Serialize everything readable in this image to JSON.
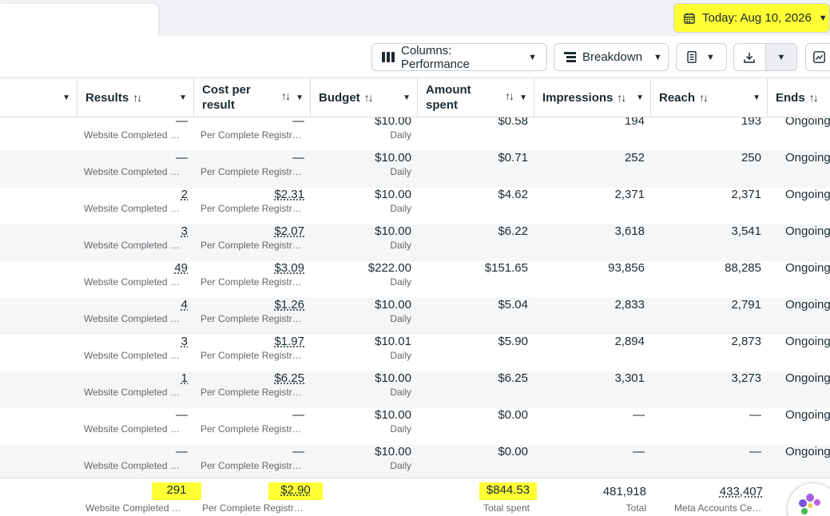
{
  "date_picker": {
    "label": "Today: Aug 10, 2026"
  },
  "toolbar": {
    "columns_label": "Columns: Performance",
    "breakdown_label": "Breakdown"
  },
  "columns": [
    {
      "label": "Results"
    },
    {
      "label": "Cost per result"
    },
    {
      "label": "Budget"
    },
    {
      "label": "Amount spent"
    },
    {
      "label": "Impressions"
    },
    {
      "label": "Reach"
    },
    {
      "label": "Ends"
    }
  ],
  "rows": [
    {
      "results": "—",
      "results_sub": "Website Completed Registrations",
      "cpr": "—",
      "cpr_sub": "Per Complete Registration",
      "budget": "$10.00",
      "budget_sub": "Daily",
      "spent": "$0.58",
      "impressions": "194",
      "reach": "193",
      "ends": "Ongoing"
    },
    {
      "results": "—",
      "results_sub": "Website Completed Registrations",
      "cpr": "—",
      "cpr_sub": "Per Complete Registration",
      "budget": "$10.00",
      "budget_sub": "Daily",
      "spent": "$0.71",
      "impressions": "252",
      "reach": "250",
      "ends": "Ongoing"
    },
    {
      "results": "2",
      "results_sub": "Website Completed Registrations",
      "cpr": "$2.31",
      "cpr_sub": "Per Complete Registration",
      "budget": "$10.00",
      "budget_sub": "Daily",
      "spent": "$4.62",
      "impressions": "2,371",
      "reach": "2,371",
      "ends": "Ongoing"
    },
    {
      "results": "3",
      "results_sub": "Website Completed Registrations",
      "cpr": "$2.07",
      "cpr_sub": "Per Complete Registration",
      "budget": "$10.00",
      "budget_sub": "Daily",
      "spent": "$6.22",
      "impressions": "3,618",
      "reach": "3,541",
      "ends": "Ongoing"
    },
    {
      "results": "49",
      "results_sub": "Website Completed Registrations",
      "cpr": "$3.09",
      "cpr_sub": "Per Complete Registration",
      "budget": "$222.00",
      "budget_sub": "Daily",
      "spent": "$151.65",
      "impressions": "93,856",
      "reach": "88,285",
      "ends": "Ongoing"
    },
    {
      "results": "4",
      "results_sub": "Website Completed Registrations",
      "cpr": "$1.26",
      "cpr_sub": "Per Complete Registration",
      "budget": "$10.00",
      "budget_sub": "Daily",
      "spent": "$5.04",
      "impressions": "2,833",
      "reach": "2,791",
      "ends": "Ongoing"
    },
    {
      "results": "3",
      "results_sub": "Website Completed Registrations",
      "cpr": "$1.97",
      "cpr_sub": "Per Complete Registration",
      "budget": "$10.01",
      "budget_sub": "Daily",
      "spent": "$5.90",
      "impressions": "2,894",
      "reach": "2,873",
      "ends": "Ongoing"
    },
    {
      "results": "1",
      "results_sub": "Website Completed Registrations",
      "cpr": "$6.25",
      "cpr_sub": "Per Complete Registration",
      "budget": "$10.00",
      "budget_sub": "Daily",
      "spent": "$6.25",
      "impressions": "3,301",
      "reach": "3,273",
      "ends": "Ongoing"
    },
    {
      "results": "—",
      "results_sub": "Website Completed Registrations",
      "cpr": "—",
      "cpr_sub": "Per Complete Registration",
      "budget": "$10.00",
      "budget_sub": "Daily",
      "spent": "$0.00",
      "impressions": "—",
      "reach": "—",
      "ends": "Ongoing"
    },
    {
      "results": "—",
      "results_sub": "Website Completed Registrations",
      "cpr": "—",
      "cpr_sub": "Per Complete Registration",
      "budget": "$10.00",
      "budget_sub": "Daily",
      "spent": "$0.00",
      "impressions": "—",
      "reach": "—",
      "ends": "Ongoing"
    }
  ],
  "totals": {
    "results": "291",
    "results_sub": "Website Completed Registrations",
    "cpr": "$2.90",
    "cpr_sub": "Per Complete Registration",
    "spent": "$844.53",
    "spent_sub": "Total spent",
    "impressions": "481,918",
    "impressions_sub": "Total",
    "reach": "433,407",
    "reach_sub": "Meta Accounts Center accounts"
  },
  "colors": {
    "highlight": "#ffff33",
    "row_alt": "#f5f6f7",
    "border": "#dadde1"
  }
}
